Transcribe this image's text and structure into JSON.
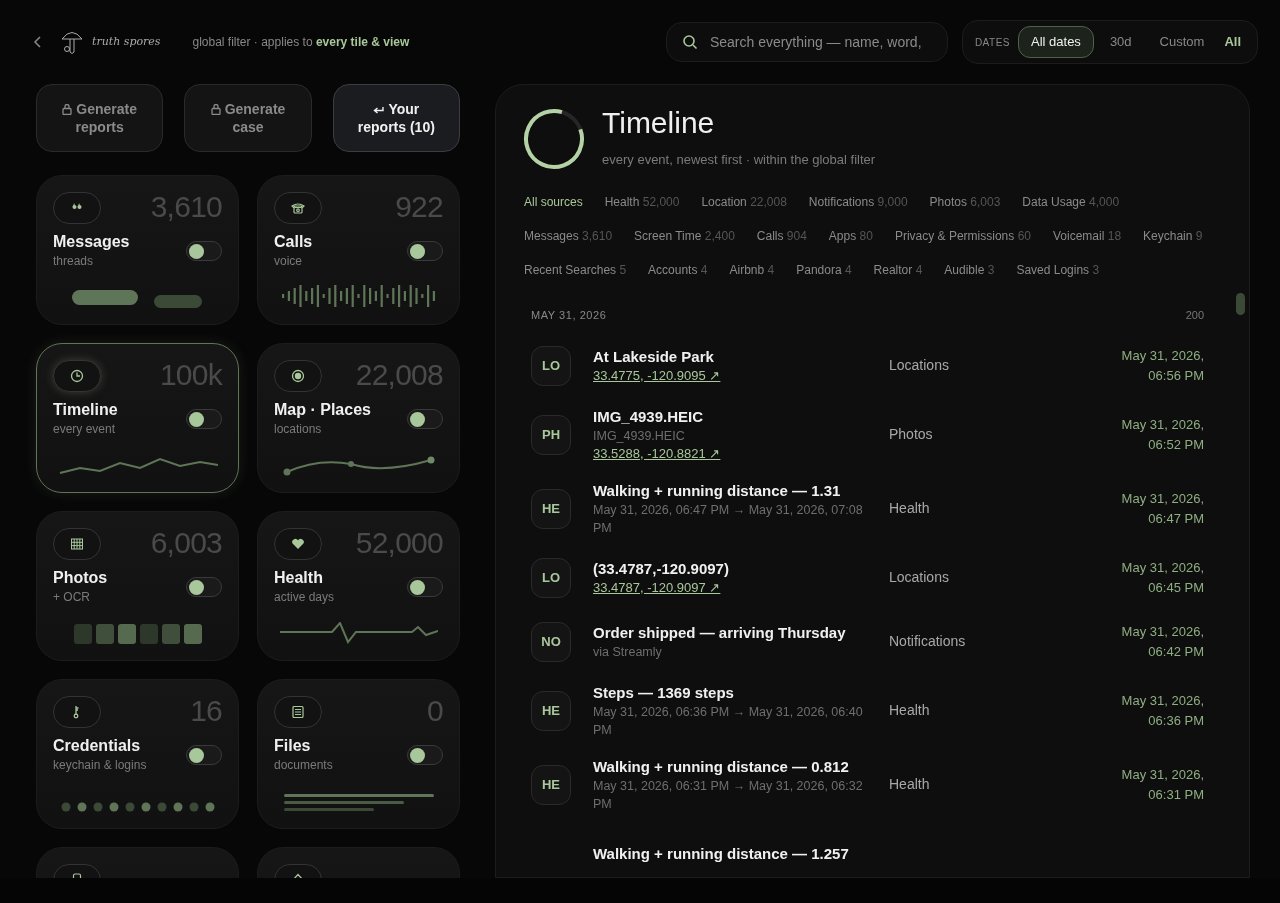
{
  "header": {
    "brand": "truth spores",
    "filter_note": "global filter · applies to **every tile & view**"
  },
  "search": {
    "placeholder": "Search everything — name, word,"
  },
  "dates": {
    "label": "DATES",
    "options": [
      {
        "label": "All dates",
        "selected": true
      },
      {
        "label": "30d",
        "selected": false
      },
      {
        "label": "Custom",
        "selected": false
      }
    ],
    "scope": "All"
  },
  "actions": [
    {
      "label": "Generate reports",
      "highlighted": false
    },
    {
      "label": "Generate case",
      "highlighted": false
    },
    {
      "label": "Your reports (10)",
      "highlighted": true
    }
  ],
  "tiles": [
    {
      "title": "Messages",
      "subtitle": "threads",
      "count": "3,610",
      "on": false,
      "selected": false
    },
    {
      "title": "Calls",
      "subtitle": "voice",
      "count": "922",
      "on": false,
      "selected": false
    },
    {
      "title": "Timeline",
      "subtitle": "every event",
      "count": "100k",
      "on": false,
      "selected": true
    },
    {
      "title": "Map · Places",
      "subtitle": "locations",
      "count": "22,008",
      "on": false,
      "selected": false
    },
    {
      "title": "Photos",
      "subtitle": "+ OCR",
      "count": "6,003",
      "on": false,
      "selected": false
    },
    {
      "title": "Health",
      "subtitle": "active days",
      "count": "52,000",
      "on": false,
      "selected": false
    },
    {
      "title": "Credentials",
      "subtitle": "keychain & logins",
      "count": "16",
      "on": false,
      "selected": false
    },
    {
      "title": "Files",
      "subtitle": "documents",
      "count": "0",
      "on": false,
      "selected": false
    },
    {
      "selected": false
    },
    {
      "selected": false
    }
  ],
  "timeline": {
    "title": "Timeline",
    "subtitle": "every event, newest first · within the global filter",
    "sources": [
      {
        "label": "All sources",
        "selected": true
      },
      {
        "label": "Health",
        "count": "52,000",
        "selected": false
      },
      {
        "label": "Location",
        "count": "22,008",
        "selected": false
      },
      {
        "label": "Notifications",
        "count": "9,000",
        "selected": false
      },
      {
        "label": "Photos",
        "count": "6,003",
        "selected": false
      },
      {
        "label": "Data Usage",
        "count": "4,000",
        "selected": false
      },
      {
        "label": "Messages",
        "count": "3,610",
        "selected": false
      },
      {
        "label": "Screen Time",
        "count": "2,400",
        "selected": false
      },
      {
        "label": "Calls",
        "count": "904",
        "selected": false
      },
      {
        "label": "Apps",
        "count": "80",
        "selected": false
      },
      {
        "label": "Privacy & Permissions",
        "count": "60",
        "selected": false
      },
      {
        "label": "Voicemail",
        "count": "18",
        "selected": false
      },
      {
        "label": "Keychain",
        "count": "9",
        "selected": false
      },
      {
        "label": "Recent Searches",
        "count": "5",
        "selected": false
      },
      {
        "label": "Accounts",
        "count": "4",
        "selected": false
      },
      {
        "label": "Airbnb",
        "count": "4",
        "selected": false
      },
      {
        "label": "Pandora",
        "count": "4",
        "selected": false
      },
      {
        "label": "Realtor",
        "count": "4",
        "selected": false
      },
      {
        "label": "Audible",
        "count": "3",
        "selected": false
      },
      {
        "label": "Saved Logins",
        "count": "3",
        "selected": false
      }
    ],
    "day": {
      "date": "MAY 31, 2026",
      "count": "200"
    },
    "events": [
      {
        "badge": "LO",
        "title": "At Lakeside Park",
        "lines": [
          {
            "kind": "link",
            "text": "33.4775, -120.9095 ↗"
          }
        ],
        "source": "Locations",
        "date": "May 31, 2026,",
        "time": "06:56 PM"
      },
      {
        "badge": "PH",
        "title": "IMG_4939.HEIC",
        "lines": [
          {
            "kind": "text",
            "text": "IMG_4939.HEIC"
          },
          {
            "kind": "link",
            "text": "33.5288, -120.8821 ↗"
          }
        ],
        "source": "Photos",
        "date": "May 31, 2026,",
        "time": "06:52 PM"
      },
      {
        "badge": "HE",
        "title": "Walking + running distance — 1.31",
        "lines": [
          {
            "kind": "text",
            "text": "May 31, 2026, 06:47 PM → May 31, 2026, 07:08 PM"
          }
        ],
        "source": "Health",
        "date": "May 31, 2026,",
        "time": "06:47 PM"
      },
      {
        "badge": "LO",
        "title": "(33.4787,-120.9097)",
        "lines": [
          {
            "kind": "link",
            "text": "33.4787, -120.9097 ↗"
          }
        ],
        "source": "Locations",
        "date": "May 31, 2026,",
        "time": "06:45 PM"
      },
      {
        "badge": "NO",
        "title": "Order shipped — arriving Thursday",
        "lines": [
          {
            "kind": "text",
            "text": "via Streamly"
          }
        ],
        "source": "Notifications",
        "date": "May 31, 2026,",
        "time": "06:42 PM"
      },
      {
        "badge": "HE",
        "title": "Steps — 1369 steps",
        "lines": [
          {
            "kind": "text",
            "text": "May 31, 2026, 06:36 PM → May 31, 2026, 06:40 PM"
          }
        ],
        "source": "Health",
        "date": "May 31, 2026,",
        "time": "06:36 PM"
      },
      {
        "badge": "HE",
        "title": "Walking + running distance — 0.812",
        "lines": [
          {
            "kind": "text",
            "text": "May 31, 2026, 06:31 PM → May 31, 2026, 06:32 PM"
          }
        ],
        "source": "Health",
        "date": "May 31, 2026,",
        "time": "06:31 PM"
      },
      {
        "title": "Walking + running distance — 1.257"
      }
    ]
  }
}
